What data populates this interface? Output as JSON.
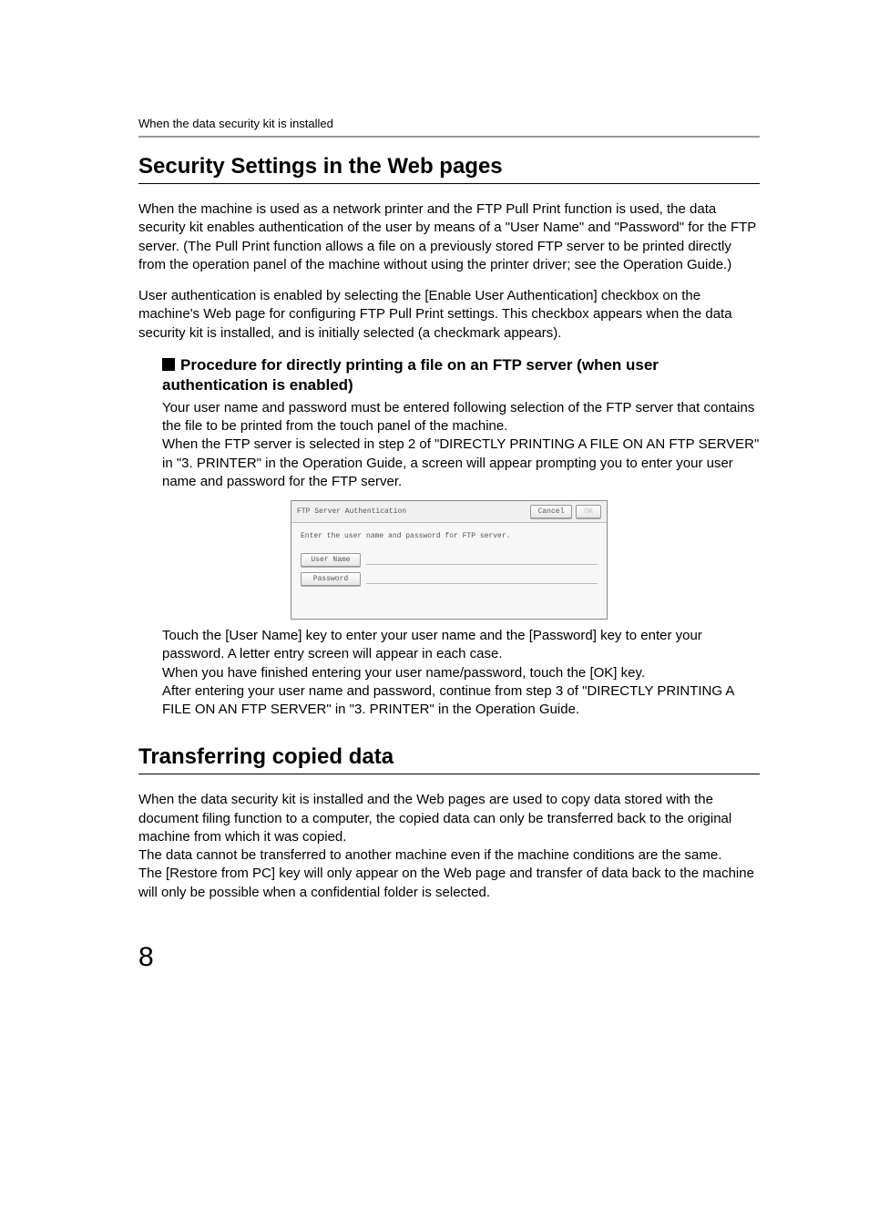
{
  "runningHead": "When the data security kit is installed",
  "section1": {
    "title": "Security Settings in the Web pages",
    "para1": "When the machine is used as a network printer and the FTP Pull Print function is used, the data security kit enables authentication of the user by means of a \"User Name\" and \"Password\" for the FTP server. (The Pull Print function allows a file on a previously stored FTP server to be printed directly from the operation panel of the machine without using the printer driver; see the Operation Guide.)",
    "para2": "User authentication is enabled by selecting the [Enable User Authentication] checkbox on the machine's Web page for configuring FTP Pull Print settings. This checkbox appears when the data security kit is installed, and is initially selected (a checkmark appears).",
    "sub": {
      "heading": "Procedure for directly printing a file on an FTP server (when user authentication is enabled)",
      "para1": "Your user name and password must be entered following selection of the FTP server that contains the file to be printed from the touch panel of the machine.",
      "para2": "When the FTP server is selected in step 2 of \"DIRECTLY PRINTING A FILE ON AN FTP SERVER\" in \"3. PRINTER\" in the Operation Guide, a screen will appear prompting you to enter your user name and password for the FTP server.",
      "dialog": {
        "title": "FTP Server Authentication",
        "cancel": "Cancel",
        "ok": "OK",
        "instruction": "Enter the user name and password for FTP server.",
        "userNameLabel": "User Name",
        "passwordLabel": "Password"
      },
      "para3": "Touch the [User Name] key to enter your user name and the [Password] key to enter your password. A letter entry screen will appear in each case.",
      "para4": "When you have finished entering your user name/password, touch the [OK] key.",
      "para5": "After entering your user name and password, continue from step 3 of \"DIRECTLY PRINTING A FILE ON AN FTP SERVER\" in \"3. PRINTER\" in the Operation Guide."
    }
  },
  "section2": {
    "title": "Transferring copied data",
    "para1": "When the data security kit is installed and the Web pages are used to copy data stored with the document filing function to a computer, the copied data can only be transferred back to the original machine from which it was copied.",
    "para2": "The data cannot be transferred to another machine even if the machine conditions are the same.",
    "para3": "The [Restore from PC] key will only appear on the Web page and transfer of data back to the machine will only be possible when a confidential folder is selected."
  },
  "pageNumber": "8"
}
